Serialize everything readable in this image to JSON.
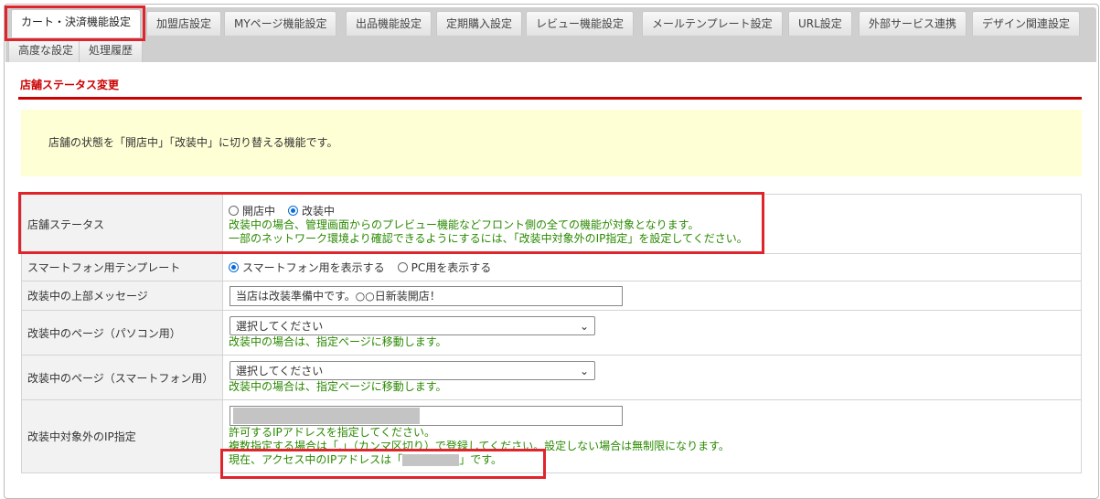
{
  "tabs_row1": [
    "カート・決済機能設定",
    "加盟店設定",
    "MYページ機能設定",
    "出品機能設定",
    "定期購入設定",
    "レビュー機能設定",
    "メールテンプレート設定",
    "URL設定",
    "外部サービス連携",
    "デザイン関連設定"
  ],
  "tabs_row2": [
    "高度な設定",
    "処理履歴"
  ],
  "section_title": "店舗ステータス変更",
  "notice": "店舗の状態を「開店中」「改装中」に切り替える機能です。",
  "rows": {
    "status": {
      "label": "店舗ステータス",
      "opt1": "開店中",
      "opt2": "改装中",
      "selected": "改装中",
      "help1": "改装中の場合、管理画面からのプレビュー機能などフロント側の全ての機能が対象となります。",
      "help2": "一部のネットワーク環境より確認できるようにするには、「改装中対象外のIP指定」を設定してください。"
    },
    "template": {
      "label": "スマートフォン用テンプレート",
      "opt1": "スマートフォン用を表示する",
      "opt2": "PC用を表示する",
      "selected": "スマートフォン用を表示する"
    },
    "message": {
      "label": "改装中の上部メッセージ",
      "value": "当店は改装準備中です。○○日新装開店！"
    },
    "pc_page": {
      "label": "改装中のページ（パソコン用）",
      "value": "選択してください",
      "help": "改装中の場合は、指定ページに移動します。"
    },
    "sp_page": {
      "label": "改装中のページ（スマートフォン用）",
      "value": "選択してください",
      "help": "改装中の場合は、指定ページに移動します。"
    },
    "ip": {
      "label": "改装中対象外のIP指定",
      "help1": "許可するIPアドレスを指定してください。",
      "help2": "複数指定する場合は「,」（カンマ区切り）で登録してください。設定しない場合は無制限になります。",
      "current_prefix": "現在、アクセス中のIPアドレスは「",
      "current_suffix": "」です。"
    }
  }
}
